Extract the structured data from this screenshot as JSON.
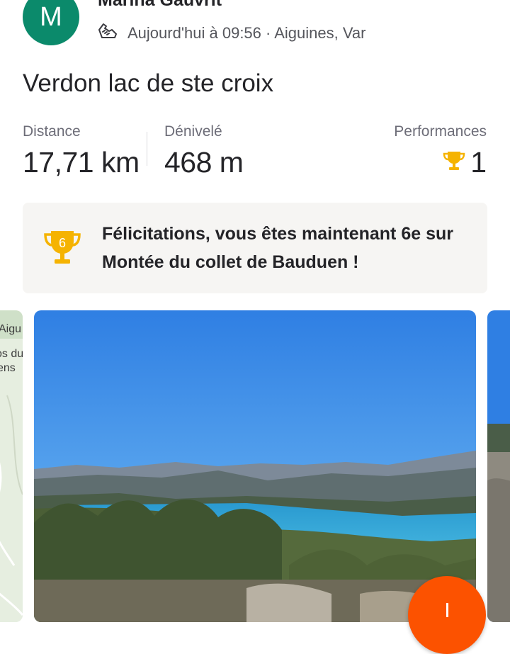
{
  "header": {
    "avatar_initial": "M",
    "athlete_name": "Marina Gauvrit",
    "activity_icon": "shoe-icon",
    "activity_meta": "Aujourd'hui à 09:56 · Aiguines, Var"
  },
  "activity": {
    "title": "Verdon lac de ste croix"
  },
  "stats": {
    "distance_label": "Distance",
    "distance_value": "17,71 km",
    "elevation_label": "Dénivelé",
    "elevation_value": "468 m",
    "performances_label": "Performances",
    "performances_value": "1",
    "performances_icon": "trophy-icon"
  },
  "achievement": {
    "rank_badge": "6",
    "message": "Félicitations, vous êtes maintenant 6e sur Montée du collet de Bauduen !"
  },
  "media": {
    "map_texts": [
      "Aigu",
      "os du",
      "ens"
    ]
  },
  "fab": {
    "icon": "plus-icon"
  },
  "colors": {
    "brand_orange": "#fc5200",
    "avatar_green": "#0b8a6b",
    "trophy_gold": "#f5b301",
    "achievement_bg": "#f6f5f3"
  }
}
